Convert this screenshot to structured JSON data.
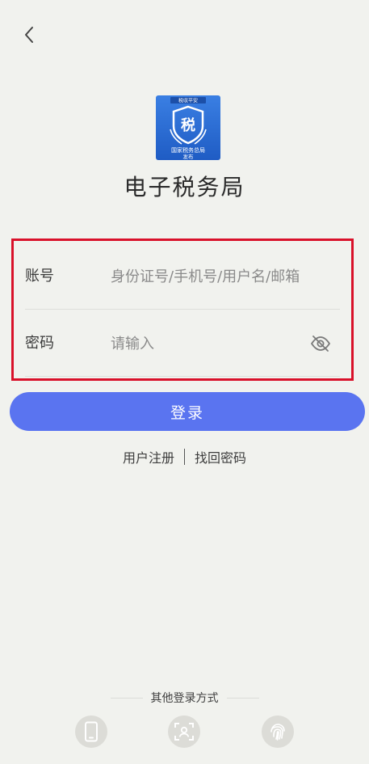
{
  "app": {
    "title": "电子税务局",
    "logo_top_text": "税収平安",
    "logo_char": "税",
    "logo_bottom_line1": "国家税务总局",
    "logo_bottom_line2": "发布"
  },
  "form": {
    "account_label": "账号",
    "account_placeholder": "身份证号/手机号/用户名/邮箱",
    "password_label": "密码",
    "password_placeholder": "请输入"
  },
  "login_button_label": "登录",
  "links": {
    "register": "用户注册",
    "recover_password": "找回密码"
  },
  "other_login": {
    "label": "其他登录方式",
    "methods": [
      "phone-icon",
      "face-scan-icon",
      "fingerprint-icon"
    ]
  },
  "colors": {
    "accent": "#5a74f0",
    "highlight_box": "#d9112a",
    "background": "#f1f2ee",
    "logo_blue": "#2f6fd8"
  }
}
